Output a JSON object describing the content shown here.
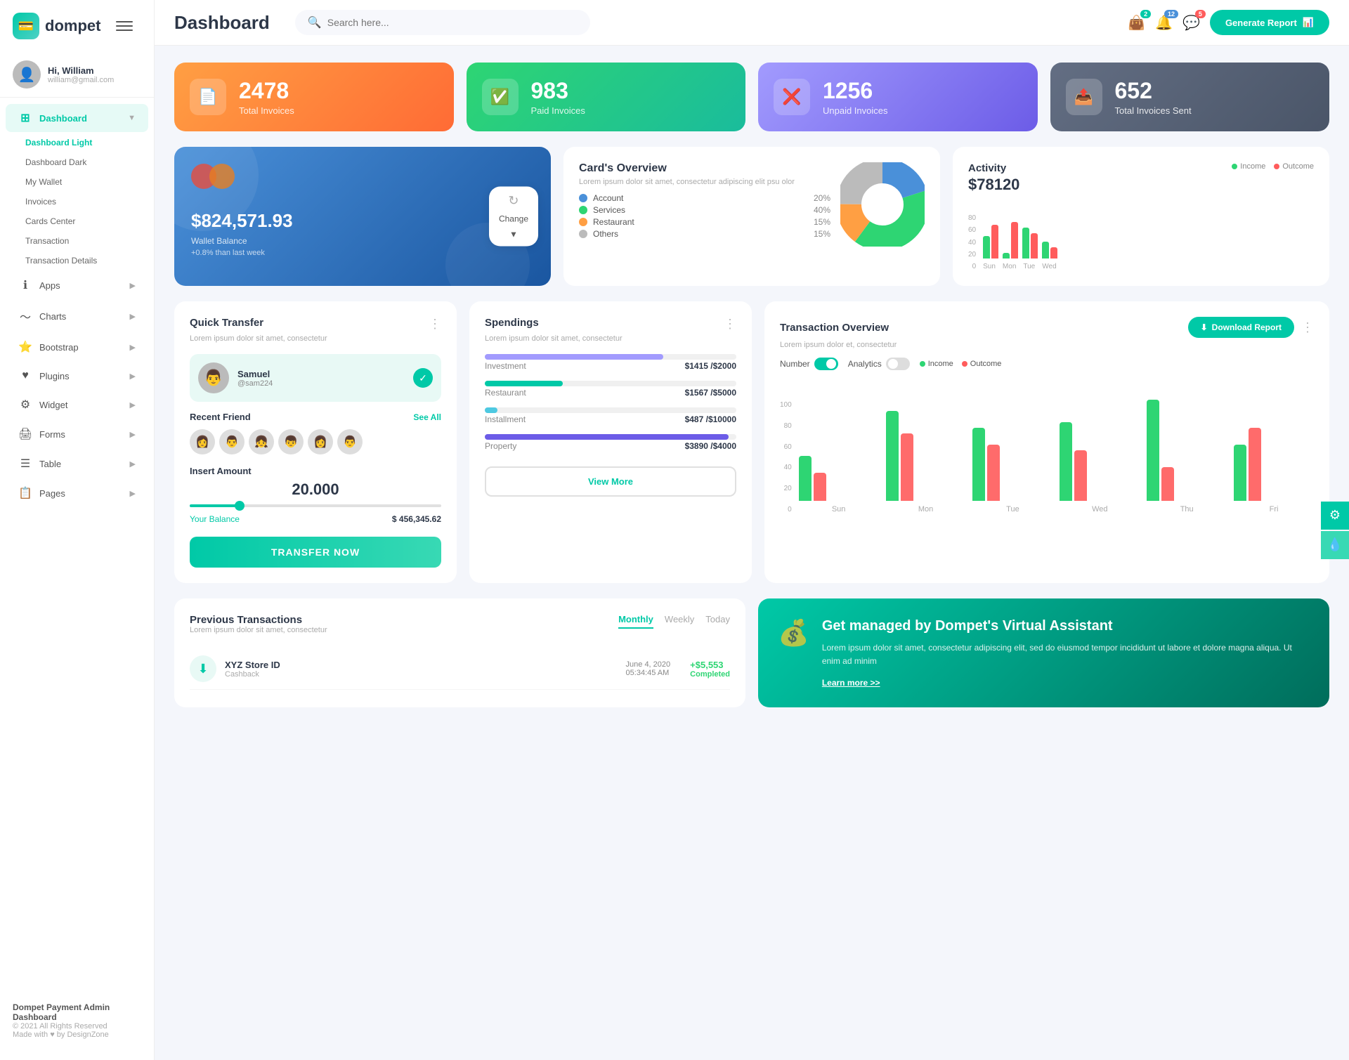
{
  "logo": {
    "text": "dompet",
    "icon": "💳"
  },
  "hamburger_label": "menu",
  "user": {
    "name": "Hi, William",
    "email": "william@gmail.com",
    "avatar": "👤"
  },
  "sidebar": {
    "nav_items": [
      {
        "id": "dashboard",
        "label": "Dashboard",
        "icon": "⊞",
        "active": true,
        "has_arrow": true
      },
      {
        "id": "apps",
        "label": "Apps",
        "icon": "ℹ",
        "active": false,
        "has_arrow": true
      },
      {
        "id": "charts",
        "label": "Charts",
        "icon": "📈",
        "active": false,
        "has_arrow": true
      },
      {
        "id": "bootstrap",
        "label": "Bootstrap",
        "icon": "⭐",
        "active": false,
        "has_arrow": true
      },
      {
        "id": "plugins",
        "label": "Plugins",
        "icon": "♥",
        "active": false,
        "has_arrow": true
      },
      {
        "id": "widget",
        "label": "Widget",
        "icon": "⚙",
        "active": false,
        "has_arrow": true
      },
      {
        "id": "forms",
        "label": "Forms",
        "icon": "🖨",
        "active": false,
        "has_arrow": true
      },
      {
        "id": "table",
        "label": "Table",
        "icon": "☰",
        "active": false,
        "has_arrow": true
      },
      {
        "id": "pages",
        "label": "Pages",
        "icon": "📋",
        "active": false,
        "has_arrow": true
      }
    ],
    "sub_nav": [
      {
        "id": "dashboard-light",
        "label": "Dashboard Light",
        "active": true
      },
      {
        "id": "dashboard-dark",
        "label": "Dashboard Dark",
        "active": false
      },
      {
        "id": "my-wallet",
        "label": "My Wallet",
        "active": false
      },
      {
        "id": "invoices",
        "label": "Invoices",
        "active": false
      },
      {
        "id": "cards-center",
        "label": "Cards Center",
        "active": false
      },
      {
        "id": "transaction",
        "label": "Transaction",
        "active": false
      },
      {
        "id": "transaction-details",
        "label": "Transaction Details",
        "active": false
      }
    ],
    "footer": {
      "brand": "Dompet Payment Admin Dashboard",
      "copy": "© 2021 All Rights Reserved",
      "made_with": "Made with ♥ by DesignZone"
    }
  },
  "header": {
    "title": "Dashboard",
    "search_placeholder": "Search here...",
    "generate_btn": "Generate Report",
    "badges": {
      "wallet": "2",
      "bell": "12",
      "chat": "5"
    }
  },
  "stats": [
    {
      "id": "total-invoices",
      "num": "2478",
      "label": "Total Invoices",
      "icon": "📄",
      "color": "orange"
    },
    {
      "id": "paid-invoices",
      "num": "983",
      "label": "Paid Invoices",
      "icon": "✅",
      "color": "green"
    },
    {
      "id": "unpaid-invoices",
      "num": "1256",
      "label": "Unpaid Invoices",
      "icon": "❌",
      "color": "purple"
    },
    {
      "id": "total-sent",
      "num": "652",
      "label": "Total Invoices Sent",
      "icon": "📤",
      "color": "slate"
    }
  ],
  "wallet": {
    "amount": "$824,571.93",
    "label": "Wallet Balance",
    "change": "+0.8% than last week",
    "change_btn_label": "Change"
  },
  "card_overview": {
    "title": "Card's Overview",
    "subtitle": "Lorem ipsum dolor sit amet, consectetur adipiscing elit psu olor",
    "legend": [
      {
        "label": "Account",
        "color": "#4a90d9",
        "pct": "20%"
      },
      {
        "label": "Services",
        "color": "#2ed573",
        "pct": "40%"
      },
      {
        "label": "Restaurant",
        "color": "#ff9f43",
        "pct": "15%"
      },
      {
        "label": "Others",
        "color": "#bbb",
        "pct": "15%"
      }
    ]
  },
  "activity": {
    "title": "Activity",
    "amount": "$78120",
    "legend": [
      {
        "label": "Income",
        "color": "green"
      },
      {
        "label": "Outcome",
        "color": "red"
      }
    ],
    "bars": [
      {
        "day": "Sun",
        "income": 40,
        "outcome": 60
      },
      {
        "day": "Mon",
        "income": 10,
        "outcome": 65
      },
      {
        "day": "Tue",
        "income": 55,
        "outcome": 45
      },
      {
        "day": "Wed",
        "income": 30,
        "outcome": 20
      }
    ]
  },
  "quick_transfer": {
    "title": "Quick Transfer",
    "subtitle": "Lorem ipsum dolor sit amet, consectetur",
    "contact": {
      "name": "Samuel",
      "handle": "@sam224",
      "avatar": "👨"
    },
    "recent_friends_label": "Recent Friend",
    "see_all": "See All",
    "friends": [
      "👩",
      "👨",
      "👧",
      "👦",
      "👩",
      "👨"
    ],
    "insert_amount_label": "Insert Amount",
    "amount": "20.000",
    "your_balance_label": "Your Balance",
    "balance": "$ 456,345.62",
    "transfer_btn": "TRANSFER NOW"
  },
  "spendings": {
    "title": "Spendings",
    "subtitle": "Lorem ipsum dolor sit amet, consectetur",
    "items": [
      {
        "label": "Investment",
        "amount": "$1415",
        "total": "$2000",
        "pct": 71,
        "color": "#a29bfe"
      },
      {
        "label": "Restaurant",
        "amount": "$1567",
        "total": "$5000",
        "pct": 31,
        "color": "#00c9a7"
      },
      {
        "label": "Installment",
        "amount": "$487",
        "total": "$10000",
        "pct": 5,
        "color": "#4ec9e1"
      },
      {
        "label": "Property",
        "amount": "$3890",
        "total": "$4000",
        "pct": 97,
        "color": "#6c5ce7"
      }
    ],
    "view_more": "View More"
  },
  "transaction_overview": {
    "title": "Transaction Overview",
    "subtitle": "Lorem ipsum dolor et, consectetur",
    "download_btn": "Download Report",
    "toggle_number": "Number",
    "toggle_analytics": "Analytics",
    "legend": [
      {
        "label": "Income",
        "color": "#2ed573"
      },
      {
        "label": "Outcome",
        "color": "#ff6b6b"
      }
    ],
    "bars": [
      {
        "day": "Sun",
        "income": 40,
        "outcome": 25
      },
      {
        "day": "Mon",
        "income": 80,
        "outcome": 60
      },
      {
        "day": "Tue",
        "income": 65,
        "outcome": 50
      },
      {
        "day": "Wed",
        "income": 70,
        "outcome": 45
      },
      {
        "day": "Thu",
        "income": 90,
        "outcome": 30
      },
      {
        "day": "Fri",
        "income": 50,
        "outcome": 65
      }
    ],
    "y_labels": [
      "100",
      "80",
      "60",
      "40",
      "20",
      "0"
    ]
  },
  "previous_transactions": {
    "title": "Previous Transactions",
    "subtitle": "Lorem ipsum dolor sit amet, consectetur",
    "tabs": [
      "Monthly",
      "Weekly",
      "Today"
    ],
    "active_tab": "Monthly",
    "items": [
      {
        "name": "XYZ Store ID",
        "type": "Cashback",
        "date": "June 4, 2020",
        "time": "05:34:45 AM",
        "amount": "+$5,553",
        "status": "Completed",
        "icon": "⬇"
      }
    ]
  },
  "virtual_assistant": {
    "title": "Get managed by Dompet's Virtual Assistant",
    "desc": "Lorem ipsum dolor sit amet, consectetur adipiscing elit, sed do eiusmod tempor incididunt ut labore et dolore magna aliqua. Ut enim ad minim",
    "learn_more": "Learn more >>",
    "icon": "💰"
  },
  "side_buttons": [
    {
      "id": "settings",
      "icon": "⚙"
    },
    {
      "id": "water-drop",
      "icon": "💧"
    }
  ]
}
